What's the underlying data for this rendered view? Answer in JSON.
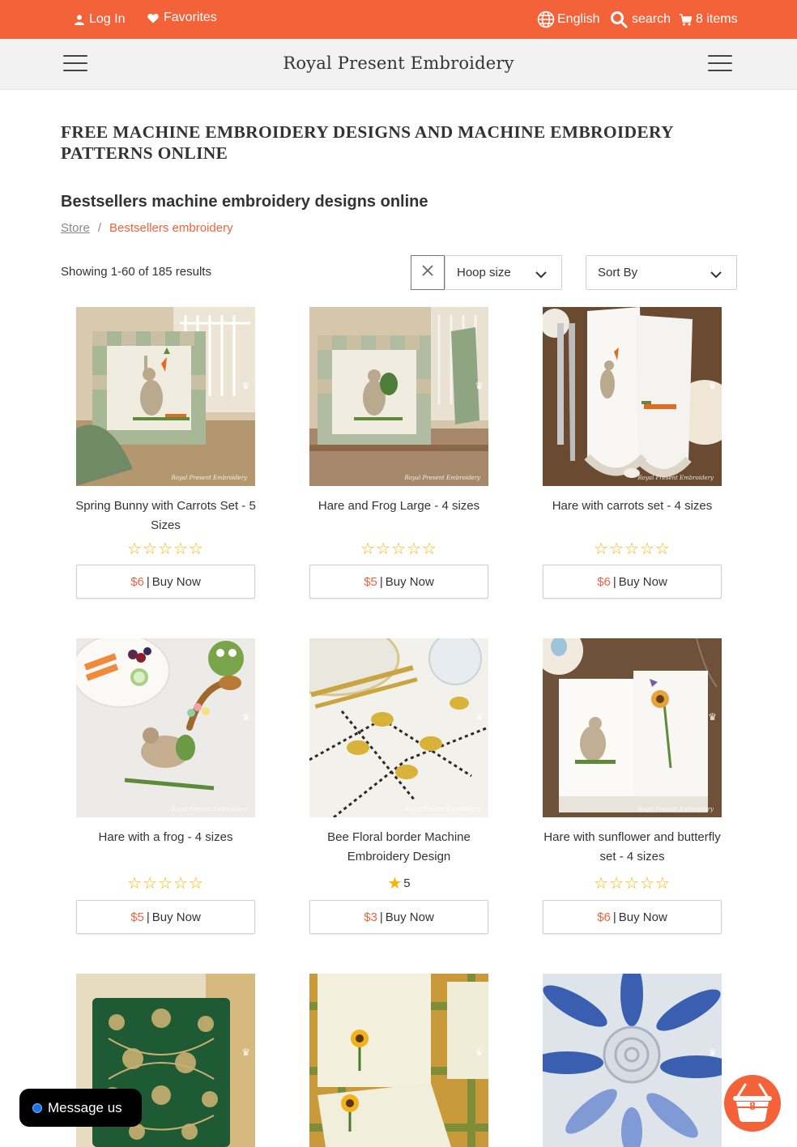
{
  "topbar": {
    "login": "Log In",
    "favorites": "Favorites",
    "language": "English",
    "search": "search",
    "cart": "8 items"
  },
  "navbar": {
    "brand": "Royal Present Embroidery"
  },
  "page": {
    "title": "FREE MACHINE EMBROIDERY DESIGNS AND MACHINE EMBROIDERY PATTERNS ONLINE",
    "section_title": "Bestsellers machine embroidery designs online",
    "breadcrumb": {
      "home": "Store",
      "separator": "/",
      "current": "Bestsellers embroidery"
    },
    "results": "Showing 1-60 of 185 results",
    "hoop_select": "Hoop size",
    "sort_select": "Sort By"
  },
  "products": [
    {
      "name": "Spring Bunny with Carrots Set - 5 Sizes",
      "price": "$6",
      "buy": "Buy Now",
      "stars": "☆☆☆☆☆",
      "rating_value": ""
    },
    {
      "name": "Hare and Frog Large - 4 sizes",
      "price": "$5",
      "buy": "Buy Now",
      "stars": "☆☆☆☆☆",
      "rating_value": ""
    },
    {
      "name": "Hare with carrots set - 4 sizes",
      "price": "$6",
      "buy": "Buy Now",
      "stars": "☆☆☆☆☆",
      "rating_value": ""
    },
    {
      "name": "Hare with a frog - 4 sizes",
      "price": "$5",
      "buy": "Buy Now",
      "stars": "☆☆☆☆☆",
      "rating_value": ""
    },
    {
      "name": "Bee Floral border Machine Embroidery Design",
      "price": "$3",
      "buy": "Buy Now",
      "stars": "★",
      "rating_value": "5"
    },
    {
      "name": "Hare with sunflower and butterfly set - 4 sizes",
      "price": "$6",
      "buy": "Buy Now",
      "stars": "☆☆☆☆☆",
      "rating_value": ""
    }
  ],
  "image_watermark": "Royal Present Embroidery",
  "chat": {
    "label": "Message us"
  },
  "cart_fab": {
    "count": "8"
  },
  "colors": {
    "accent": "#f4623a",
    "star": "#f5b400",
    "navbar": "#f2f2f2"
  }
}
